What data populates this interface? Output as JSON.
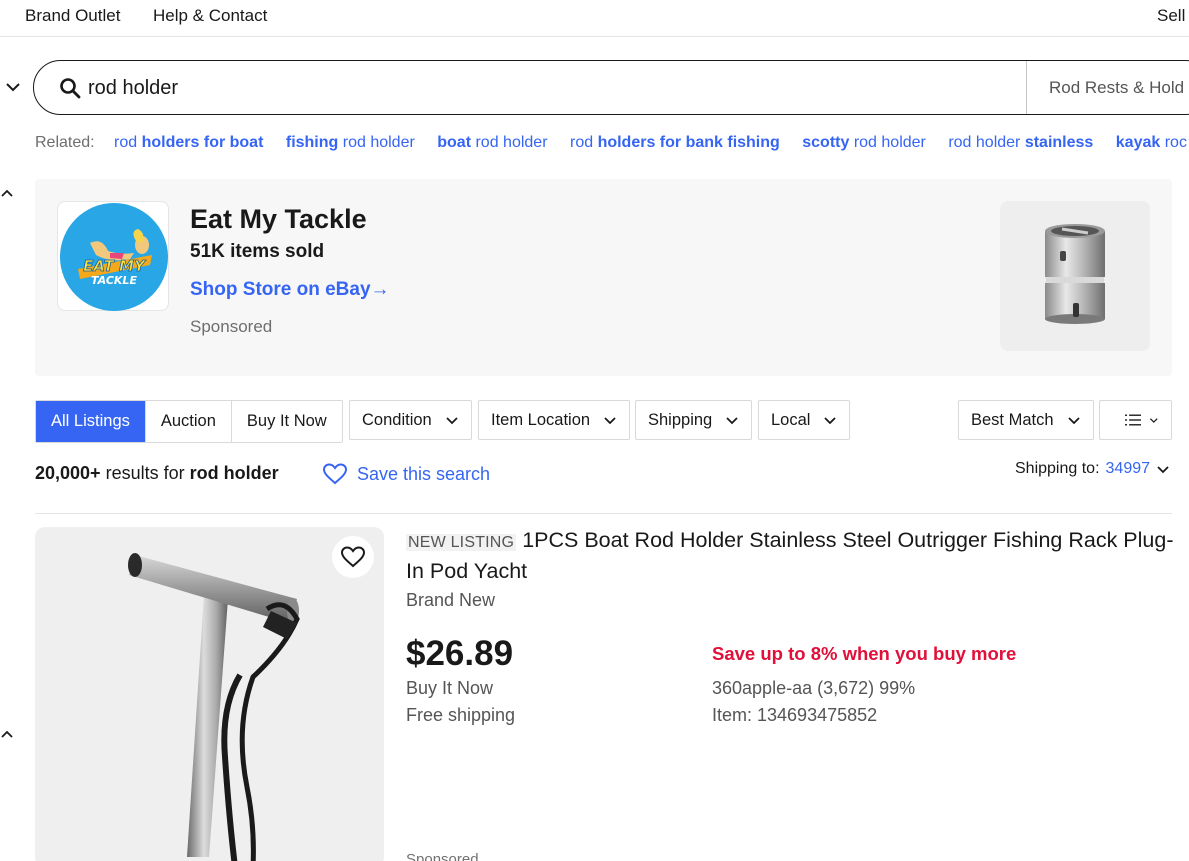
{
  "topnav": {
    "brand_outlet": "Brand Outlet",
    "help_contact": "Help & Contact",
    "sell": "Sell"
  },
  "search": {
    "query": "rod holder",
    "category": "Rod Rests & Hold"
  },
  "related": {
    "label": "Related:",
    "items": [
      {
        "pre": "rod ",
        "bold": "holders for boat",
        "post": ""
      },
      {
        "pre": "",
        "bold": "fishing",
        "post": " rod holder"
      },
      {
        "pre": "",
        "bold": "boat",
        "post": " rod holder"
      },
      {
        "pre": "rod ",
        "bold": "holders for bank fishing",
        "post": ""
      },
      {
        "pre": "",
        "bold": "scotty",
        "post": " rod holder"
      },
      {
        "pre": "rod holder ",
        "bold": "stainless",
        "post": ""
      },
      {
        "pre": "",
        "bold": "kayak",
        "post": " roc"
      }
    ]
  },
  "store": {
    "name": "Eat My Tackle",
    "sold": "51K items sold",
    "link": "Shop Store on eBay",
    "link_arrow": "→",
    "sponsored": "Sponsored",
    "logo_text_1": "EAT MY",
    "logo_text_2": "TACKLE"
  },
  "filters": {
    "segments": [
      "All Listings",
      "Auction",
      "Buy It Now"
    ],
    "active_segment": "All Listings",
    "condition": "Condition",
    "item_location": "Item Location",
    "shipping": "Shipping",
    "local": "Local",
    "sort": "Best Match"
  },
  "results": {
    "count": "20,000+",
    "text_mid": " results for ",
    "query": "rod holder",
    "save_search": "Save this search",
    "ship_to_label": "Shipping to:",
    "zip": "34997"
  },
  "listing": {
    "badge": "NEW LISTING",
    "title": "1PCS Boat Rod Holder Stainless Steel Outrigger Fishing Rack Plug-In Pod Yacht",
    "condition": "Brand New",
    "price": "$26.89",
    "format": "Buy It Now",
    "shipping": "Free shipping",
    "promo": "Save up to 8% when you buy more",
    "seller": "360apple-aa (3,672) 99%",
    "item_number": "Item: 134693475852",
    "sponsored": "Sponsored"
  },
  "colors": {
    "link_blue": "#3665f3",
    "promo_red": "#e0103a",
    "store_logo_blue": "#29a6e6"
  }
}
